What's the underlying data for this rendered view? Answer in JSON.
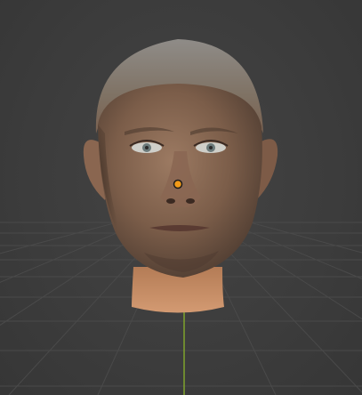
{
  "viewport": {
    "background_color": "#3d3d3d",
    "grid_color": "#4a4a4a",
    "y_axis_color": "#7fa32c",
    "origin_color": "#f29a18",
    "grid_visible": true
  },
  "object": {
    "type": "head-mesh",
    "selected_origin_visible": true
  }
}
